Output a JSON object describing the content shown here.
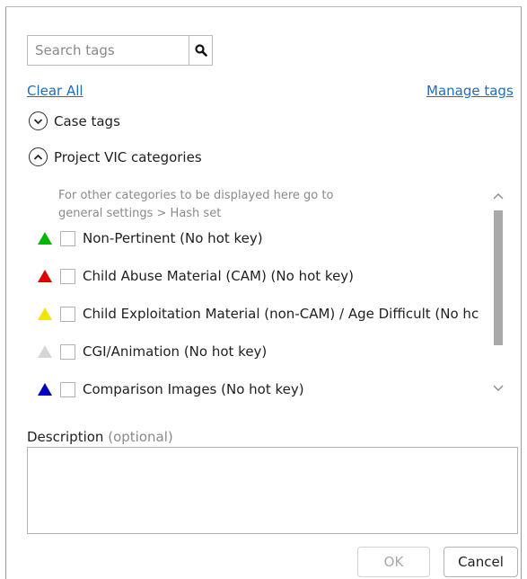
{
  "search": {
    "placeholder": "Search tags"
  },
  "links": {
    "clear_all": "Clear All",
    "manage_tags": "Manage tags"
  },
  "sections": {
    "case_tags": {
      "label": "Case tags",
      "state": "collapsed"
    },
    "project_vic": {
      "label": "Project VIC categories",
      "state": "expanded"
    }
  },
  "hint": {
    "line1": "For other categories to be displayed here go to",
    "line2": "general settings > Hash set"
  },
  "tags": [
    {
      "label": "Non-Pertinent (No hot key)",
      "color": "#00b800",
      "checked": false
    },
    {
      "label": "Child Abuse Material (CAM) (No hot key)",
      "color": "#e00000",
      "checked": false
    },
    {
      "label": "Child Exploitation Material  (non-CAM) / Age Difficult (No hc",
      "color": "#f2e600",
      "checked": false
    },
    {
      "label": "CGI/Animation (No hot key)",
      "color": "#d6d6d6",
      "checked": false
    },
    {
      "label": "Comparison Images (No hot key)",
      "color": "#0000c0",
      "checked": false
    }
  ],
  "description": {
    "label": "Description",
    "optional": "(optional)",
    "value": ""
  },
  "buttons": {
    "ok": "OK",
    "cancel": "Cancel",
    "ok_enabled": false
  },
  "colors": {
    "link": "#1a6fc4",
    "hint": "#8a8a8a",
    "scroll_thumb": "#a9a9a9"
  }
}
